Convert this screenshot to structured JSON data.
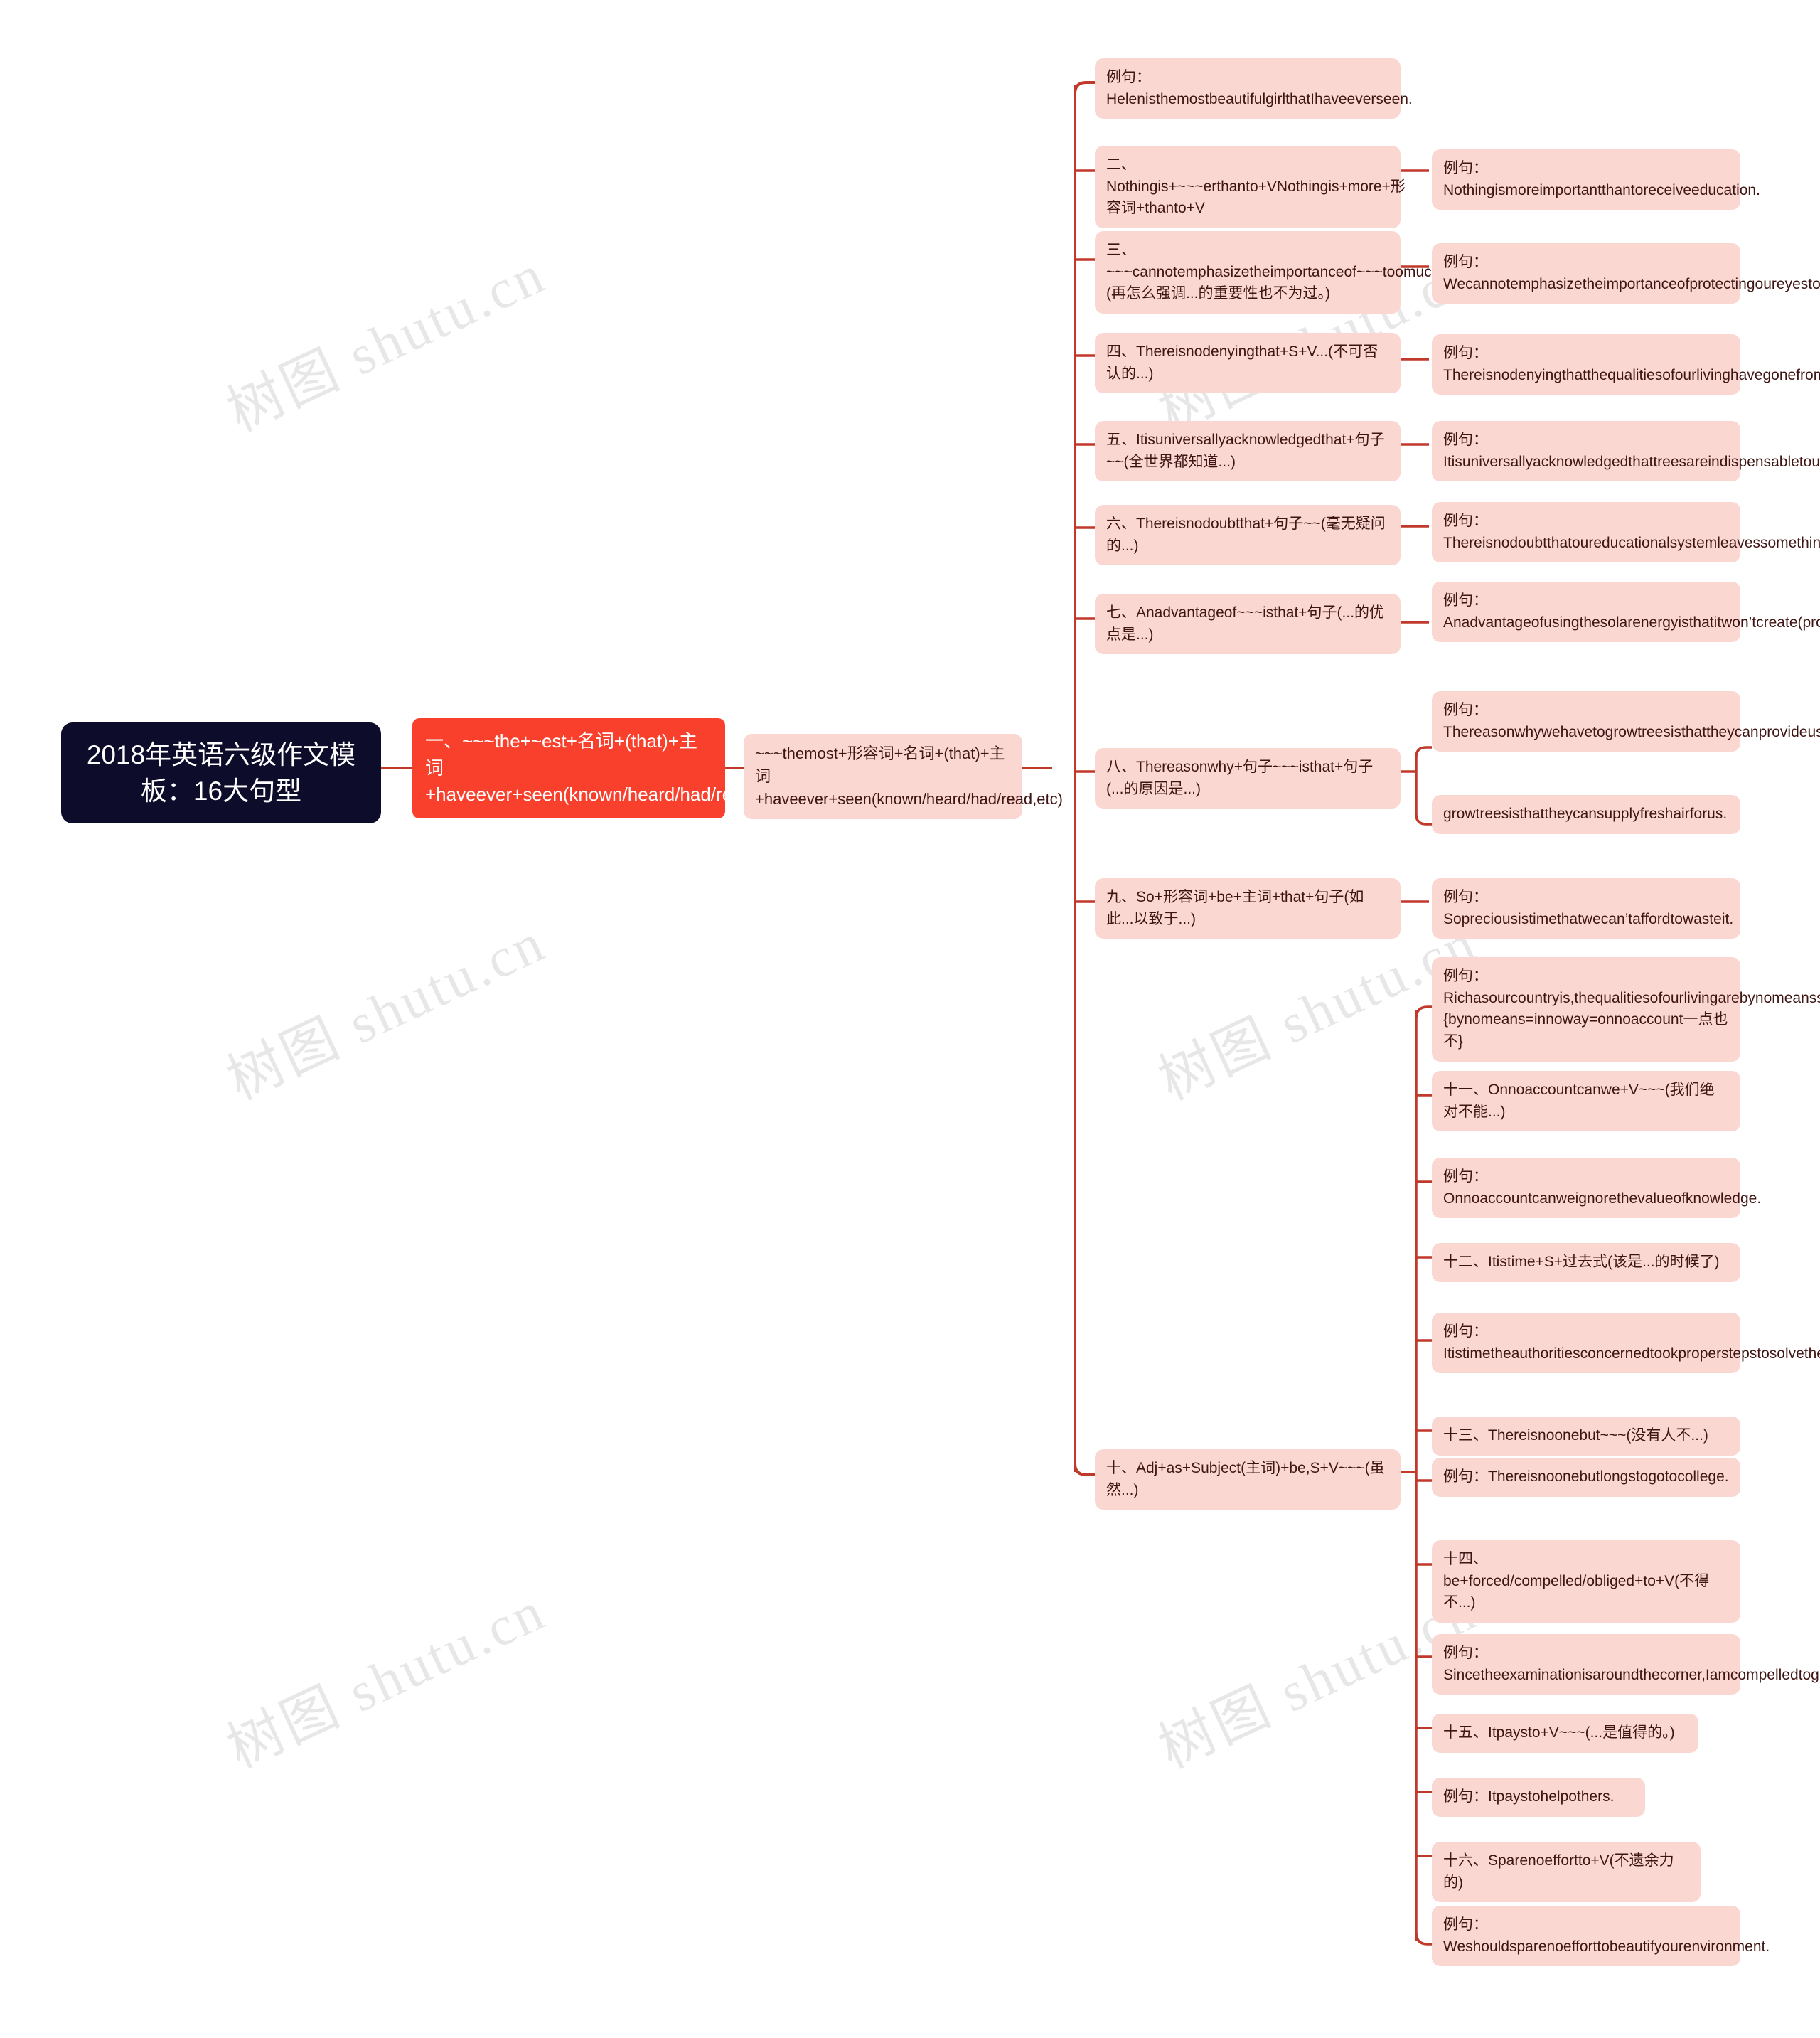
{
  "meta": {
    "colors": {
      "root_bg": "#0d0d2b",
      "root_text": "#ffffff",
      "branch_bg": "#f9402c",
      "branch_text": "#ffffff",
      "node_bg": "#fbd7d2",
      "node_text": "#3e1512",
      "connector": "#c0392b",
      "canvas": "#ffffff"
    },
    "watermark_text": "树图 shutu.cn"
  },
  "root": {
    "label": "2018年英语六级作文模板：16大句型"
  },
  "branch": {
    "label": "一、~~~the+~est+名词+(that)+主词+haveever+seen(known/heard/had/read,etc)"
  },
  "sub_branch": {
    "label": "~~~themost+形容词+名词+(that)+主词+haveever+seen(known/heard/had/read,etc)"
  },
  "patterns": [
    {
      "id": "p1-example",
      "label": "例句：HelenisthemostbeautifulgirlthatIhaveeverseen.",
      "examples": []
    },
    {
      "id": "p2",
      "label": "二、Nothingis+~~~erthanto+VNothingis+more+形容词+thanto+V",
      "examples": [
        "例句：Nothingismoreimportantthantoreceiveeducation."
      ]
    },
    {
      "id": "p3",
      "label": "三、~~~cannotemphasizetheimportanceof~~~toomuch.(再怎么强调...的重要性也不为过。)",
      "examples": [
        "例句：Wecannotemphasizetheimportanceofprotectingoureyestoomuch."
      ]
    },
    {
      "id": "p4",
      "label": "四、Thereisnodenyingthat+S+V...(不可否认的...)",
      "examples": [
        "例句：Thereisnodenyingthatthequalitiesofourlivinghavegonefrombadtoworse."
      ]
    },
    {
      "id": "p5",
      "label": "五、Itisuniversallyacknowledgedthat+句子~~(全世界都知道...)",
      "examples": [
        "例句：Itisuniversallyacknowledgedthattreesareindispensabletous."
      ]
    },
    {
      "id": "p6",
      "label": "六、Thereisnodoubtthat+句子~~(毫无疑问的...)",
      "examples": [
        "例句：Thereisnodoubtthatoureducationalsystemleavessomethingtobedesired."
      ]
    },
    {
      "id": "p7",
      "label": "七、Anadvantageof~~~isthat+句子(...的优点是...)",
      "examples": [
        "例句：Anadvantageofusingthesolarenergyisthatitwon’tcreate(produce)anypollution."
      ]
    },
    {
      "id": "p8",
      "label": "八、Thereasonwhy+句子~~~isthat+句子(...的原因是...)",
      "examples": [
        "例句：Thereasonwhywehavetogrowtreesisthattheycanprovideuswithfreshair./Thereasonwhywehaveto",
        "growtreesisthattheycansupplyfreshairforus."
      ]
    },
    {
      "id": "p9",
      "label": "九、So+形容词+be+主词+that+句子(如此...以致于...)",
      "examples": [
        "例句：Sopreciousistimethatwecan’taffordtowasteit."
      ]
    },
    {
      "id": "p10",
      "label": "十、Adj+as+Subject(主词)+be,S+V~~~(虽然...)",
      "examples": [
        "例句：Richasourcountryis,thequalitiesofourlivingarebynomeanssatisfactory.{bynomeans=innoway=onnoaccount一点也不}",
        "十一、Onnoaccountcanwe+V~~~(我们绝对不能...)",
        "例句：Onnoaccountcanweignorethevalueofknowledge.",
        "十二、Itistime+S+过去式(该是...的时候了)",
        "例句：Itistimetheauthoritiesconcernedtookproperstepstosolvethetrafficproblems.",
        "十三、Thereisnoonebut~~~(没有人不...)",
        "例句：Thereisnoonebutlongstogotocollege.",
        "十四、be+forced/compelled/obliged+to+V(不得不...)",
        "例句：Sincetheexaminationisaroundthecorner,Iamcompelledtogiveupdoingsports.",
        "十五、Itpaysto+V~~~(...是值得的。)",
        "例句：Itpaystohelpothers.",
        "十六、Sparenoeffortto+V(不遗余力的)",
        "例句：Weshouldsparenoefforttobeautifyourenvironment."
      ]
    }
  ]
}
